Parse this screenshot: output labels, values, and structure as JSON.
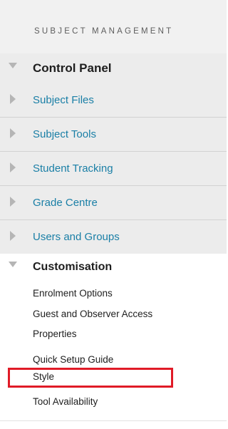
{
  "section": {
    "title": "SUBJECT MANAGEMENT"
  },
  "control_panel": {
    "label": "Control Panel",
    "items": [
      {
        "label": "Subject Files"
      },
      {
        "label": "Subject Tools"
      },
      {
        "label": "Student Tracking"
      },
      {
        "label": "Grade Centre"
      },
      {
        "label": "Users and Groups"
      }
    ]
  },
  "customisation": {
    "label": "Customisation",
    "items": [
      {
        "label": "Enrolment Options"
      },
      {
        "label": "Guest and Observer Access"
      },
      {
        "label": "Properties"
      },
      {
        "label": "Quick Setup Guide"
      },
      {
        "label": "Style"
      },
      {
        "label": "Tool Availability"
      }
    ]
  },
  "colors": {
    "link": "#1a7fa6",
    "highlight": "#e01b27",
    "menu_background": "#ececec"
  }
}
